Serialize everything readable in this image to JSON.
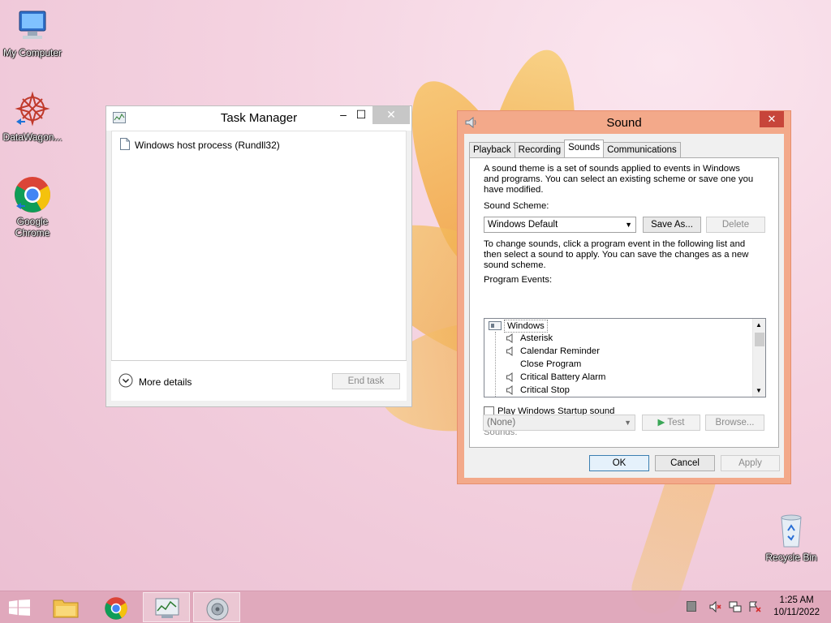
{
  "desktop": {
    "icons": [
      {
        "label": "My Computer"
      },
      {
        "label": "DataWagon..."
      },
      {
        "label": "Google Chrome"
      },
      {
        "label": "Recycle Bin"
      }
    ]
  },
  "task_manager": {
    "title": "Task Manager",
    "process": "Windows host process (Rundll32)",
    "more_details": "More details",
    "end_task": "End task",
    "minimize": "–",
    "maximize": "☐",
    "close": "✕"
  },
  "sound_dialog": {
    "title": "Sound",
    "close": "✕",
    "tabs": [
      "Playback",
      "Recording",
      "Sounds",
      "Communications"
    ],
    "active_tab": "Sounds",
    "intro_lines": [
      "A sound theme is a set of sounds applied to events in Windows",
      "and programs.  You can select an existing scheme or save one you",
      "have modified."
    ],
    "scheme_label": "Sound Scheme:",
    "scheme_value": "Windows Default",
    "save_as": "Save As...",
    "delete": "Delete",
    "change_lines": [
      "To change sounds, click a program event in the following list and",
      "then select a sound to apply.  You can save the changes as a new",
      "sound scheme."
    ],
    "events_label": "Program Events:",
    "events": [
      {
        "label": "Windows",
        "type": "group"
      },
      {
        "label": "Asterisk",
        "type": "sound"
      },
      {
        "label": "Calendar Reminder",
        "type": "sound"
      },
      {
        "label": "Close Program",
        "type": "none"
      },
      {
        "label": "Critical Battery Alarm",
        "type": "sound"
      },
      {
        "label": "Critical Stop",
        "type": "sound"
      }
    ],
    "startup_label": "Play Windows Startup sound",
    "sounds_label": "Sounds:",
    "sounds_value": "(None)",
    "test": "Test",
    "browse": "Browse...",
    "ok": "OK",
    "cancel": "Cancel",
    "apply": "Apply"
  },
  "taskbar": {
    "time": "1:25 AM",
    "date": "10/11/2022"
  },
  "colors": {
    "sound_frame": "#f3a98a",
    "close_red": "#c7453a",
    "taskbar": "#dea6ba"
  }
}
